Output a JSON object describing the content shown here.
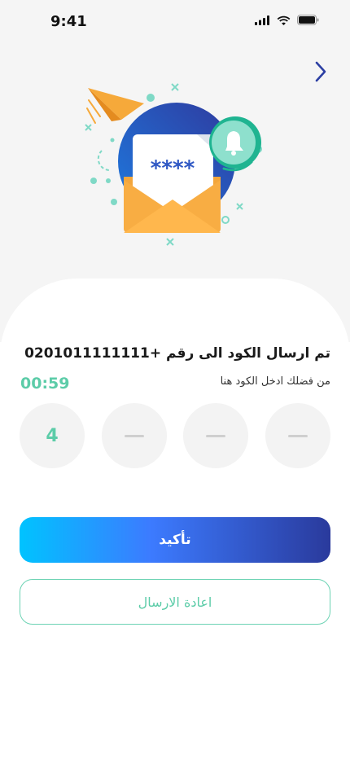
{
  "status_bar": {
    "time": "9:41",
    "icons": [
      "signal-icon",
      "wifi-icon",
      "battery-icon"
    ]
  },
  "header": {
    "back_icon": "chevron-right-icon"
  },
  "illustration": {
    "code_mask": "****",
    "icons": [
      "paper-plane-icon",
      "envelope-icon",
      "bell-icon"
    ]
  },
  "verification": {
    "title": "تم ارسال الكود الى رقم +0201011111111",
    "subtitle": "من فضلك ادخل الكود هنا",
    "timer": "00:59",
    "otp_digits": [
      "",
      "",
      "",
      "4"
    ]
  },
  "actions": {
    "confirm_label": "تأكيد",
    "resend_label": "اعادة الارسال"
  },
  "colors": {
    "accent": "#5ccca8",
    "primary_dark": "#2a3a9c",
    "primary_light": "#00c3ff",
    "background": "#f5f5f5"
  }
}
